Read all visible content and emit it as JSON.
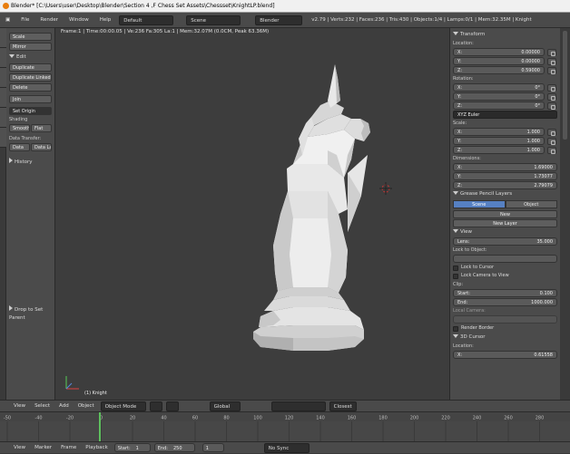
{
  "window": {
    "title": "Blender* [C:\\Users\\user\\Desktop\\Blender\\Section 4 ,F Chess Set Assets\\Chessset\\KnightLP.blend]"
  },
  "menubar": {
    "items": [
      "File",
      "Render",
      "Window",
      "Help"
    ],
    "layout": "Default",
    "scene": "Scene",
    "engine": "Blender Render",
    "stats": "v2.79 | Verts:232 | Faces:236 | Tris:430 | Objects:1/4 | Lamps:0/1 | Mem:32.35M | Knight"
  },
  "toolshelf": {
    "buttons_top": [
      "Scale",
      "Mirror"
    ],
    "edit_header": "Edit",
    "edit_buttons": [
      "Duplicate",
      "Duplicate Linked",
      "Delete",
      "Join"
    ],
    "set_origin": "Set Origin",
    "shading_label": "Shading",
    "smooth": "Smooth",
    "flat": "Flat",
    "data_transfer_label": "Data Transfer:",
    "data": "Data",
    "data_la": "Data La",
    "history": "History",
    "drop_parent": "Drop to Set Parent"
  },
  "viewport": {
    "info": "Frame:1 | Time:00:00.05 | Ve:236 Fa:305 La:1 | Mem:32.07M (0.0CM, Peak 63.36M)",
    "object_label": "(1) Knight"
  },
  "properties": {
    "transform": "Transform",
    "location": "Location:",
    "loc": [
      {
        "axis": "X:",
        "value": "0.00000"
      },
      {
        "axis": "Y:",
        "value": "0.00000"
      },
      {
        "axis": "Z:",
        "value": "0.59000"
      }
    ],
    "rotation": "Rotation:",
    "rot": [
      {
        "axis": "X:",
        "value": "0°"
      },
      {
        "axis": "Y:",
        "value": "0°"
      },
      {
        "axis": "Z:",
        "value": "0°"
      }
    ],
    "euler": "XYZ Euler",
    "scale_label": "Scale:",
    "scale": [
      {
        "axis": "X:",
        "value": "1.000"
      },
      {
        "axis": "Y:",
        "value": "1.000"
      },
      {
        "axis": "Z:",
        "value": "1.000"
      }
    ],
    "dimensions": "Dimensions:",
    "dim": [
      {
        "axis": "X:",
        "value": "1.69000"
      },
      {
        "axis": "Y:",
        "value": "1.73077"
      },
      {
        "axis": "Z:",
        "value": "2.79079"
      }
    ],
    "gp_layers": "Grease Pencil Layers",
    "gp_tab_scene": "Scene",
    "gp_tab_object": "Object",
    "gp_new": "New",
    "gp_new_layer": "New Layer",
    "view": "View",
    "lens_label": "Lens:",
    "lens_value": "35.000",
    "lock_to_object": "Lock to Object:",
    "lock_to_cursor": "Lock to Cursor",
    "lock_camera": "Lock Camera to View",
    "clip": "Clip:",
    "clip_start_label": "Start:",
    "clip_start": "0.100",
    "clip_end_label": "End:",
    "clip_end": "1000.000",
    "local_camera": "Local Camera:",
    "render_border": "Render Border",
    "cursor_3d": "3D Cursor",
    "cursor_location": "Location:",
    "cursor_x_label": "X:",
    "cursor_x": "0.61558"
  },
  "viewport_header": {
    "items": [
      "View",
      "Select",
      "Add",
      "Object"
    ],
    "mode": "Object Mode",
    "pivot": "Global",
    "layer": "Closest"
  },
  "timeline": {
    "ticks": [
      "-50",
      "-40",
      "-20",
      "0",
      "20",
      "40",
      "60",
      "80",
      "100",
      "120",
      "140",
      "160",
      "180",
      "200",
      "220",
      "240",
      "260",
      "280"
    ],
    "items": [
      "View",
      "Marker",
      "Frame",
      "Playback"
    ],
    "start_label": "Start:",
    "start": "1",
    "end_label": "End:",
    "end": "250",
    "frame": "1",
    "sync": "No Sync"
  }
}
